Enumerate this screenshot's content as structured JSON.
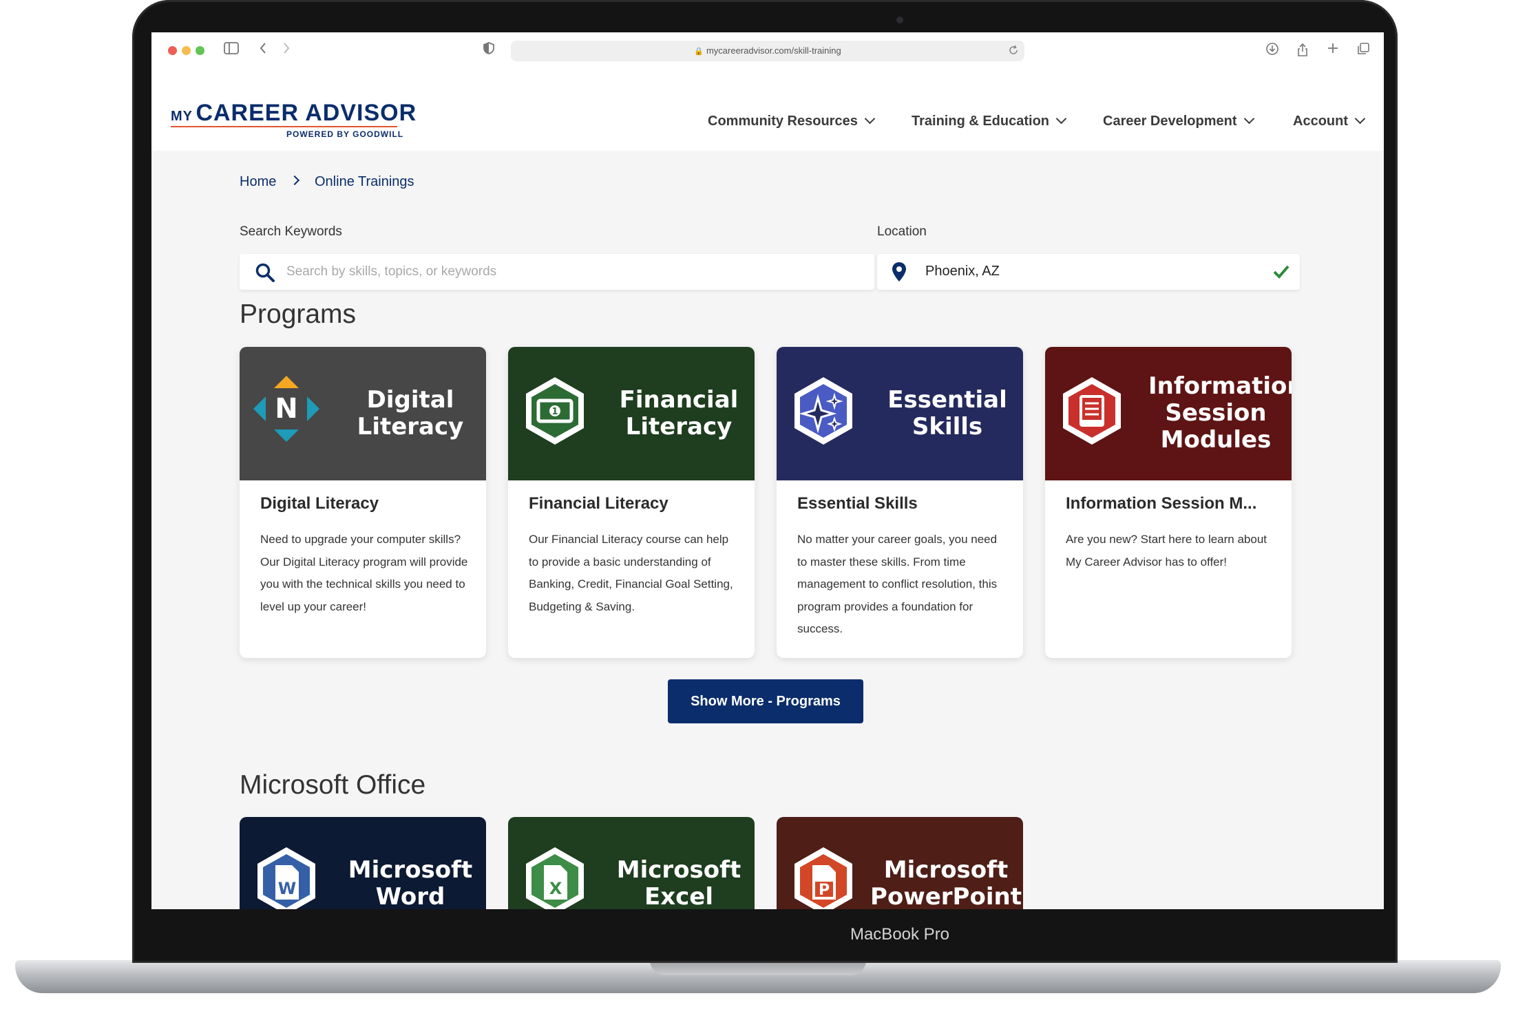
{
  "device": {
    "model_label": "MacBook Pro"
  },
  "browser": {
    "url": "mycareeradvisor.com/skill-training"
  },
  "site": {
    "logo": {
      "my": "MY",
      "name": "CAREER ADVISOR",
      "tagline": "POWERED BY GOODWILL"
    },
    "nav": [
      {
        "label": "Community Resources"
      },
      {
        "label": "Training & Education"
      },
      {
        "label": "Career Development"
      },
      {
        "label": "Account"
      }
    ]
  },
  "breadcrumb": [
    {
      "label": "Home"
    },
    {
      "label": "Online Trainings"
    }
  ],
  "search": {
    "keywords_label": "Search Keywords",
    "keywords_placeholder": "Search by skills, topics, or keywords",
    "location_label": "Location",
    "location_value": "Phoenix, AZ"
  },
  "programs": {
    "heading": "Programs",
    "cards": [
      {
        "banner_title": "Digital Literacy",
        "title": "Digital Literacy",
        "description": "Need to upgrade your computer skills? Our Digital Literacy program will provide you with the technical skills you need to level up your career!",
        "color": "#474747",
        "badge_letter": "N"
      },
      {
        "banner_title": "Financial Literacy",
        "title": "Financial Literacy",
        "description": "Our Financial Literacy course can help to provide a basic understanding of Banking, Credit, Financial Goal Setting, Budgeting & Saving.",
        "color": "#1f3d1f",
        "badge_letter": "1"
      },
      {
        "banner_title": "Essential Skills",
        "title": "Essential Skills",
        "description": "No matter your career goals, you need to master these skills. From time management to conflict resolution, this program provides a foundation for success.",
        "color": "#252a5e",
        "badge_letter": ""
      },
      {
        "banner_title": "Information Session Modules",
        "title": "Information Session M...",
        "description": "Are you new? Start here to learn about My Career Advisor has to offer!",
        "color": "#5e1414",
        "badge_letter": ""
      }
    ],
    "show_more_label": "Show More - Programs"
  },
  "microsoft_office": {
    "heading": "Microsoft Office",
    "cards": [
      {
        "banner_title": "Microsoft Word",
        "color": "#0d1a33",
        "badge_letter": "W"
      },
      {
        "banner_title": "Microsoft Excel",
        "color": "#1f3d1f",
        "badge_letter": "X"
      },
      {
        "banner_title": "Microsoft PowerPoint",
        "color": "#4e1e17",
        "badge_letter": "P"
      }
    ]
  },
  "colors": {
    "brand_navy": "#0b2d6b",
    "accent_orange": "#e2552d",
    "success_green": "#2e8b3d"
  }
}
